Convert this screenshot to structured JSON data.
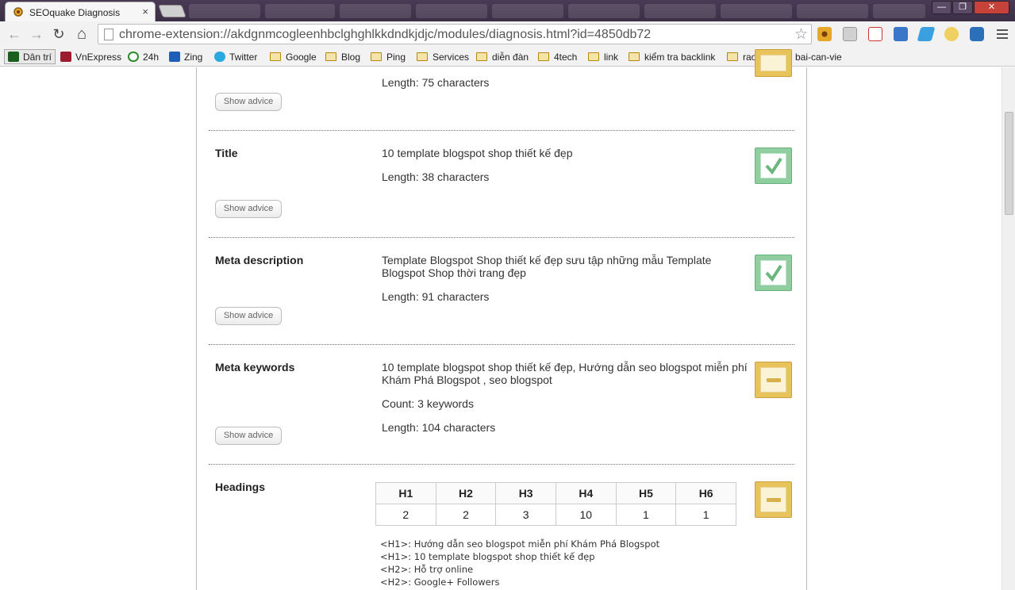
{
  "browser": {
    "tab_title": "SEOquake Diagnosis",
    "tab_close": "×",
    "url": "chrome-extension://akdgnmcogleenhbclghghlkkdndkjdjc/modules/diagnosis.html?id=4850db72",
    "window_minimize": "—",
    "window_maximize": "❐",
    "window_close": "✕",
    "back": "←",
    "forward": "→",
    "reload": "↻",
    "home": "⌂",
    "star": "☆"
  },
  "bookmarks": [
    {
      "label": "Dân trí",
      "icon": "dantri-icon",
      "color": "#1b5e20"
    },
    {
      "label": "VnExpress",
      "icon": "vnexpress-icon",
      "color": "#9b1c2e"
    },
    {
      "label": "24h",
      "icon": "24h-icon",
      "color": "#2e8b2e"
    },
    {
      "label": "Zing",
      "icon": "zing-icon",
      "color": "#1d5fb8"
    },
    {
      "label": "Twitter",
      "icon": "twitter-icon",
      "color": "#2aa9e0"
    },
    {
      "label": "Google",
      "icon": "folder-icon"
    },
    {
      "label": "Blog",
      "icon": "folder-icon"
    },
    {
      "label": "Ping",
      "icon": "folder-icon"
    },
    {
      "label": "Services",
      "icon": "folder-icon"
    },
    {
      "label": "diễn đàn",
      "icon": "folder-icon"
    },
    {
      "label": "4tech",
      "icon": "folder-icon"
    },
    {
      "label": "link",
      "icon": "folder-icon"
    },
    {
      "label": "kiểm tra backlink",
      "icon": "folder-icon"
    },
    {
      "label": "raovat",
      "icon": "folder-icon"
    },
    {
      "label": "bai-can-vie",
      "icon": "folder-icon"
    }
  ],
  "diagnosis": {
    "top_item": {
      "length": "Length: 75 characters",
      "advice": "Show advice",
      "status": "warning"
    },
    "title": {
      "label": "Title",
      "value": "10 template blogspot shop thiết kế đẹp",
      "length": "Length: 38 characters",
      "advice": "Show advice",
      "status": "ok"
    },
    "meta_description": {
      "label": "Meta description",
      "value_line1": "Template Blogspot Shop thiết kế đẹp sưu tập những mẫu Template",
      "value_line2": "Blogspot Shop thời trang đẹp",
      "length": "Length: 91 characters",
      "advice": "Show advice",
      "status": "ok"
    },
    "meta_keywords": {
      "label": "Meta keywords",
      "value_line1": "10 template blogspot shop thiết kế đẹp, Hướng dẫn seo blogspot miễn phí",
      "value_line2": "Khám Phá Blogspot , seo blogspot",
      "count": "Count: 3 keywords",
      "length": "Length: 104 characters",
      "advice": "Show advice",
      "status": "warning"
    },
    "headings": {
      "label": "Headings",
      "columns": [
        "H1",
        "H2",
        "H3",
        "H4",
        "H5",
        "H6"
      ],
      "counts": [
        "2",
        "2",
        "3",
        "10",
        "1",
        "1"
      ],
      "list": [
        "<H1>: Hướng dẫn seo blogspot miễn phí Khám Phá Blogspot",
        "<H1>: 10 template blogspot shop thiết kế đẹp",
        "<H2>: Hỗ trợ online",
        "<H2>: Google+ Followers"
      ],
      "status": "warning"
    }
  },
  "colors": {
    "ok": "#8fcf9f",
    "warning": "#e8c25a",
    "tabstrip": "#3b2f46"
  }
}
